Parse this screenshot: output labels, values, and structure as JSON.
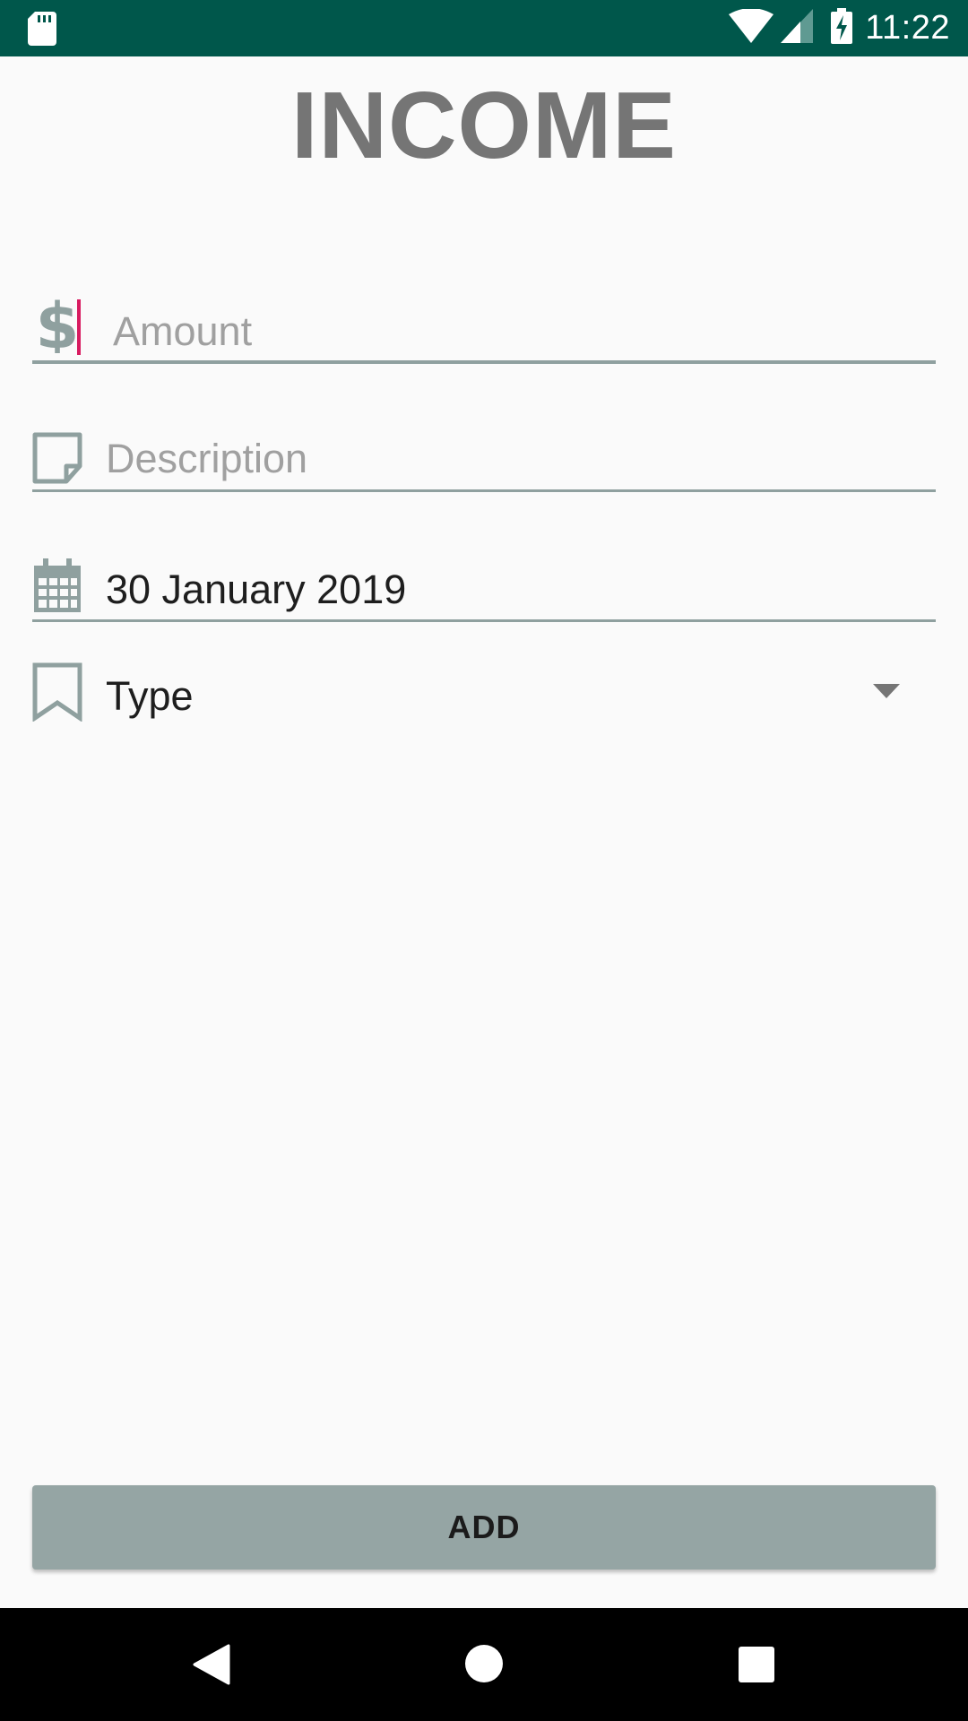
{
  "status_bar": {
    "time": "11:22",
    "icons": [
      "sd-card-icon",
      "wifi-icon",
      "signal-icon",
      "battery-charging-icon"
    ]
  },
  "header": {
    "title": "INCOME"
  },
  "form": {
    "amount": {
      "placeholder": "Amount",
      "value": "",
      "icon": "dollar-icon"
    },
    "description": {
      "placeholder": "Description",
      "value": "",
      "icon": "note-icon"
    },
    "date": {
      "value": "30 January 2019",
      "icon": "calendar-icon"
    },
    "type": {
      "selected": "Type",
      "icon": "bookmark-icon",
      "dropdown_icon": "dropdown-arrow-icon"
    }
  },
  "actions": {
    "add_label": "ADD"
  },
  "colors": {
    "status_bar": "#00574b",
    "accent_cursor": "#d81b60",
    "icon_gray": "#8fa09f",
    "button_bg": "#95a5a4",
    "title_gray": "#757575"
  },
  "nav_bar": {
    "icons": [
      "back-icon",
      "home-icon",
      "recents-icon"
    ]
  }
}
